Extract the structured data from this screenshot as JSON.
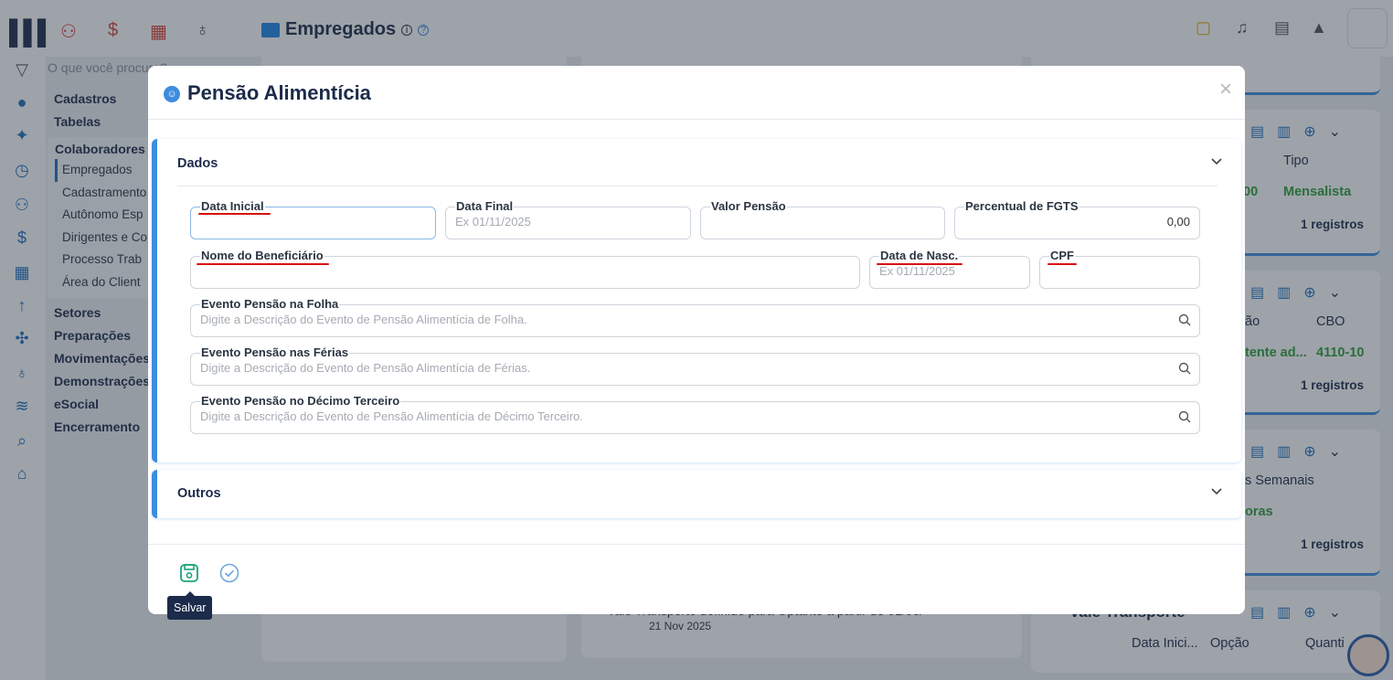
{
  "app": {
    "page_title": "Empregados",
    "search_placeholder": "O que você procura?",
    "menu_top": [
      "Cadastros",
      "Tabelas"
    ],
    "submenu_title": "Colaboradores",
    "submenu_items": [
      "Empregados",
      "Cadastramento",
      "Autônomo Esp",
      "Dirigentes e Co",
      "Processo Trab",
      "Área do Client"
    ],
    "menu_bottom": [
      "Setores",
      "Preparações",
      "Movimentações",
      "Demonstrações",
      "eSocial",
      "Encerramento"
    ]
  },
  "bg_cards": [
    {
      "col1": "Tipo",
      "col2": "",
      "green1": "00",
      "green2": "Mensalista",
      "regs": "1 registros"
    },
    {
      "col1": "ão",
      "col2": "CBO",
      "green1": "tente ad...",
      "green2": "4110-10",
      "regs": "1 registros"
    },
    {
      "col1": "s Semanais",
      "col2": "",
      "green1": "oras",
      "green2": "",
      "regs": "1 registros"
    },
    {
      "col1": "Data Inici...",
      "col2": "Opção",
      "col3": "Quanti",
      "title": "Vale Transporte"
    }
  ],
  "bg_notice": {
    "text": "Vale Transporte definido para Optante a partir de 01/06/",
    "date": "21 Nov 2025"
  },
  "modal": {
    "title": "Pensão Alimentícia",
    "close": "×",
    "sections": {
      "dados": {
        "title": "Dados"
      },
      "outros": {
        "title": "Outros"
      }
    },
    "fields": {
      "data_inicial": {
        "label": "Data Inicial",
        "placeholder": ""
      },
      "data_final": {
        "label": "Data Final",
        "placeholder": "Ex 01/11/2025"
      },
      "valor_pensao": {
        "label": "Valor Pensão",
        "placeholder": ""
      },
      "percentual_fgts": {
        "label": "Percentual de FGTS",
        "value": "0,00"
      },
      "nome_beneficiario": {
        "label": "Nome do Beneficiário",
        "placeholder": ""
      },
      "data_nasc": {
        "label": "Data de Nasc.",
        "placeholder": "Ex 01/11/2025"
      },
      "cpf": {
        "label": "CPF",
        "placeholder": ""
      },
      "evento_folha": {
        "label": "Evento Pensão na Folha",
        "placeholder": "Digite a Descrição do Evento de Pensão Alimentícia de Folha."
      },
      "evento_ferias": {
        "label": "Evento Pensão nas Férias",
        "placeholder": "Digite a Descrição do Evento de Pensão Alimentícia de Férias."
      },
      "evento_decimo": {
        "label": "Evento Pensão no Décimo Terceiro",
        "placeholder": "Digite a Descrição do Evento de Pensão Alimentícia de Décimo Terceiro."
      }
    },
    "footer": {
      "save_tooltip": "Salvar"
    }
  },
  "colors": {
    "accent": "#3c8dde",
    "title": "#1c2b4a",
    "required_underline": "#d80f0f",
    "save_green": "#1aa37a"
  },
  "icons": [
    "logo",
    "users-icon",
    "dollar-icon",
    "calculator-icon",
    "money-bag-icon",
    "monitor-icon",
    "info-icon",
    "help-icon",
    "document-icon",
    "bell-icon",
    "doc-search-icon",
    "graduation-icon",
    "filter-icon",
    "search-icon",
    "save-icon",
    "check-circle-icon",
    "chevron-down-icon",
    "close-icon"
  ]
}
